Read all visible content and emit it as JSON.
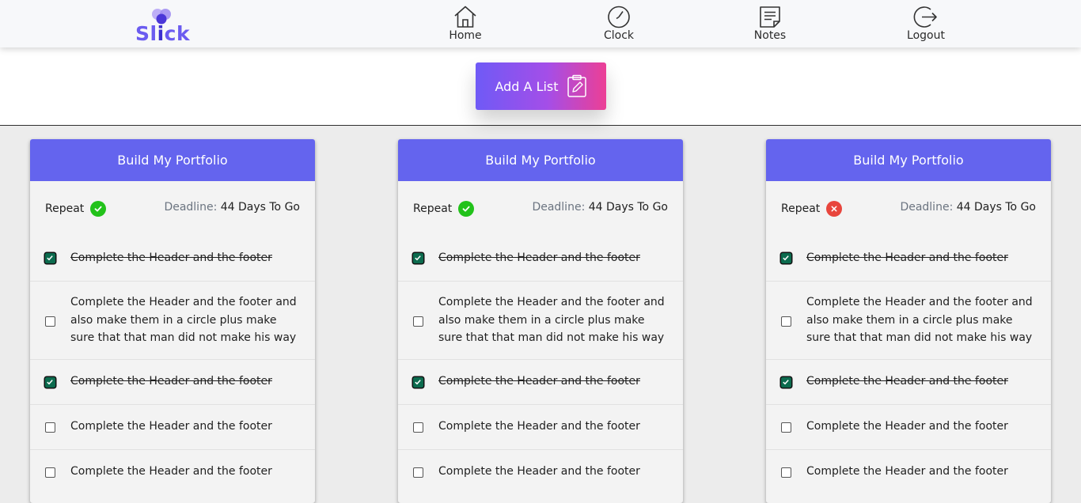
{
  "app": {
    "logo_text_pre": "Sl",
    "logo_text_i": "i",
    "logo_text_post": "ck"
  },
  "nav": [
    {
      "label": "Home",
      "icon": "home-icon"
    },
    {
      "label": "Clock",
      "icon": "clock-icon"
    },
    {
      "label": "Notes",
      "icon": "notes-icon"
    },
    {
      "label": "Logout",
      "icon": "logout-icon"
    }
  ],
  "add_button": {
    "label": "Add A List",
    "icon": "clipboard-edit-icon"
  },
  "colors": {
    "accent": "#6464ee",
    "repeat_on": "#22c21a",
    "repeat_off": "#e8453c",
    "checkbox_checked": "#0c6b4e"
  },
  "cards": [
    {
      "title": "Build My Portfolio",
      "repeat_label": "Repeat",
      "repeat": true,
      "deadline_label": "Deadline:",
      "deadline_value": "44 Days To Go",
      "tasks": [
        {
          "text": "Complete the Header and the footer",
          "done": true
        },
        {
          "text": "Complete the Header and the footer and also make them in a circle plus make sure that that man did not make his way",
          "done": false
        },
        {
          "text": "Complete the Header and the footer",
          "done": true
        },
        {
          "text": "Complete the Header and the footer",
          "done": false
        },
        {
          "text": "Complete the Header and the footer",
          "done": false
        }
      ]
    },
    {
      "title": "Build My Portfolio",
      "repeat_label": "Repeat",
      "repeat": true,
      "deadline_label": "Deadline:",
      "deadline_value": "44 Days To Go",
      "tasks": [
        {
          "text": "Complete the Header and the footer",
          "done": true
        },
        {
          "text": "Complete the Header and the footer and also make them in a circle plus make sure that that man did not make his way",
          "done": false
        },
        {
          "text": "Complete the Header and the footer",
          "done": true
        },
        {
          "text": "Complete the Header and the footer",
          "done": false
        },
        {
          "text": "Complete the Header and the footer",
          "done": false
        }
      ]
    },
    {
      "title": "Build My Portfolio",
      "repeat_label": "Repeat",
      "repeat": false,
      "deadline_label": "Deadline:",
      "deadline_value": "44 Days To Go",
      "tasks": [
        {
          "text": "Complete the Header and the footer",
          "done": true
        },
        {
          "text": "Complete the Header and the footer and also make them in a circle plus make sure that that man did not make his way",
          "done": false
        },
        {
          "text": "Complete the Header and the footer",
          "done": true
        },
        {
          "text": "Complete the Header and the footer",
          "done": false
        },
        {
          "text": "Complete the Header and the footer",
          "done": false
        }
      ]
    }
  ]
}
